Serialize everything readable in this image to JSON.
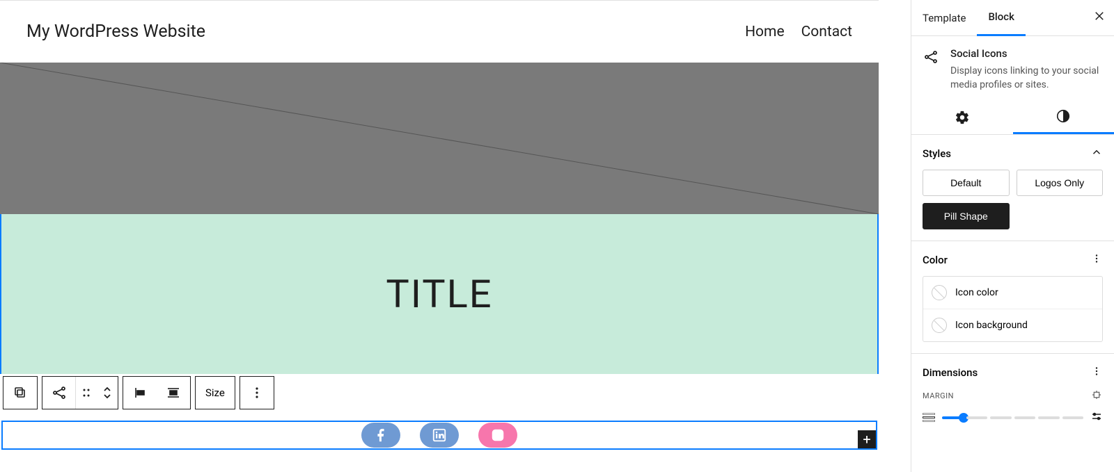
{
  "header": {
    "site_title": "My WordPress Website",
    "nav": [
      "Home",
      "Contact"
    ]
  },
  "content": {
    "title": "TITLE"
  },
  "toolbar": {
    "size_label": "Size"
  },
  "social": {
    "items": [
      {
        "name": "facebook",
        "bg": "#6f9ad3"
      },
      {
        "name": "linkedin",
        "bg": "#6f9ad3"
      },
      {
        "name": "instagram",
        "bg": "#f776ac"
      }
    ]
  },
  "sidebar": {
    "tabs": {
      "template": "Template",
      "block": "Block"
    },
    "block": {
      "title": "Social Icons",
      "description": "Display icons linking to your social media profiles or sites."
    },
    "styles": {
      "heading": "Styles",
      "options": {
        "default": "Default",
        "logos_only": "Logos Only",
        "pill": "Pill Shape"
      }
    },
    "color": {
      "heading": "Color",
      "icon_color": "Icon color",
      "icon_background": "Icon background"
    },
    "dimensions": {
      "heading": "Dimensions",
      "margin_label": "MARGIN"
    }
  }
}
